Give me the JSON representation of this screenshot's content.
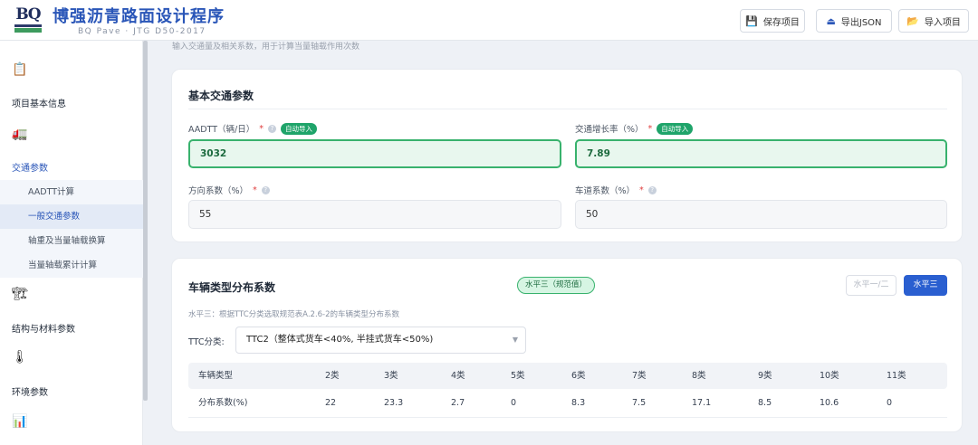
{
  "header": {
    "logo_text": "BQ",
    "title": "博强沥青路面设计程序",
    "subtitle": "BQ Pave · JTG D50-2017",
    "buttons": [
      {
        "label": "保存项目",
        "icon": "save-icon"
      },
      {
        "label": "导出JSON",
        "icon": "export-icon"
      },
      {
        "label": "导入项目",
        "icon": "folder-icon"
      }
    ]
  },
  "sidebar": {
    "sections": [
      {
        "label": "项目基本信息",
        "icon": "clipboard-icon"
      },
      {
        "label": "交通参数",
        "icon": "truck-icon"
      },
      {
        "label": "结构与材料参数",
        "icon": "layers-icon"
      },
      {
        "label": "环境参数",
        "icon": "thermometer-icon"
      },
      {
        "label": "",
        "icon": "chart-icon"
      }
    ],
    "sub_items": [
      "AADTT计算",
      "一般交通参数",
      "轴重及当量轴载换算",
      "当量轴载累计计算"
    ]
  },
  "main": {
    "hint": "输入交通量及相关系数，用于计算当量轴载作用次数",
    "basic": {
      "title": "基本交通参数",
      "aadtt": {
        "label": "AADTT（辆/日）",
        "required": "*",
        "help": "?",
        "auto_badge": "自动导入",
        "value": "3032"
      },
      "growth": {
        "label": "交通增长率（%）",
        "required": "*",
        "help": "?",
        "auto_badge": "自动导入",
        "value": "7.89"
      },
      "direction": {
        "label": "方向系数（%）",
        "required": "*",
        "help": "?",
        "value": "55"
      },
      "lane": {
        "label": "车道系数（%）",
        "required": "*",
        "help": "?",
        "value": "50"
      }
    },
    "vehicle": {
      "title": "车辆类型分布系数",
      "level_badge": "水平三（规范值）",
      "level_btn_12": "水平一/二",
      "level_btn_3": "水平三",
      "description": "水平三：根据TTC分类选取规范表A.2.6-2的车辆类型分布系数",
      "ttc_label": "TTC分类:",
      "ttc_value": "TTC2（整体式货车<40%, 半挂式货车<50%)",
      "table": {
        "headers": [
          "车辆类型",
          "2类",
          "3类",
          "4类",
          "5类",
          "6类",
          "7类",
          "8类",
          "9类",
          "10类",
          "11类"
        ],
        "row": [
          "分布系数(%)",
          "22",
          "23.3",
          "2.7",
          "0",
          "8.3",
          "7.5",
          "17.1",
          "8.5",
          "10.6",
          "0"
        ]
      }
    }
  }
}
